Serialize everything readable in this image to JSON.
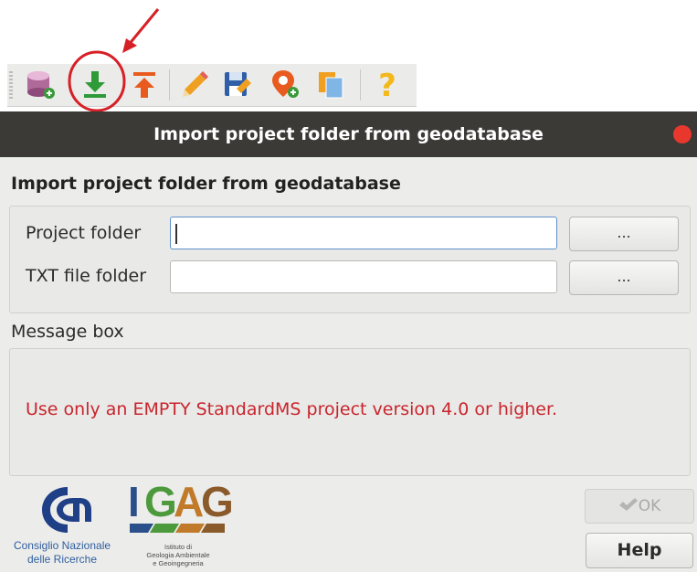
{
  "toolbar": {
    "icons": [
      "database-add-icon",
      "import-icon",
      "export-icon",
      "edit-icon",
      "save-edit-icon",
      "location-add-icon",
      "copy-icon",
      "help-icon"
    ]
  },
  "dialog": {
    "window_title": "Import project folder from geodatabase",
    "heading": "Import project folder from geodatabase",
    "project_folder_label": "Project folder",
    "project_folder_value": "",
    "txt_folder_label": "TXT file folder",
    "txt_folder_value": "",
    "browse_label": "...",
    "message_box_label": "Message box",
    "message": "Use only an EMPTY StandardMS project version 4.0 or higher.",
    "ok_label": "OK",
    "help_label": "Help"
  },
  "logos": {
    "cnr_line1": "Consiglio Nazionale",
    "cnr_line2": "delle Ricerche",
    "igag_letters": [
      "I",
      "G",
      "A",
      "G"
    ],
    "igag_sub1": "Istituto di",
    "igag_sub2": "Geologia Ambientale",
    "igag_sub3": "e Geoingegneria"
  },
  "colors": {
    "titlebar": "#3b3a36",
    "close": "#e8382e",
    "message": "#c9252d",
    "annotation": "#d61f26",
    "import_icon": "#2e9a38",
    "export_icon": "#e85a1d"
  }
}
